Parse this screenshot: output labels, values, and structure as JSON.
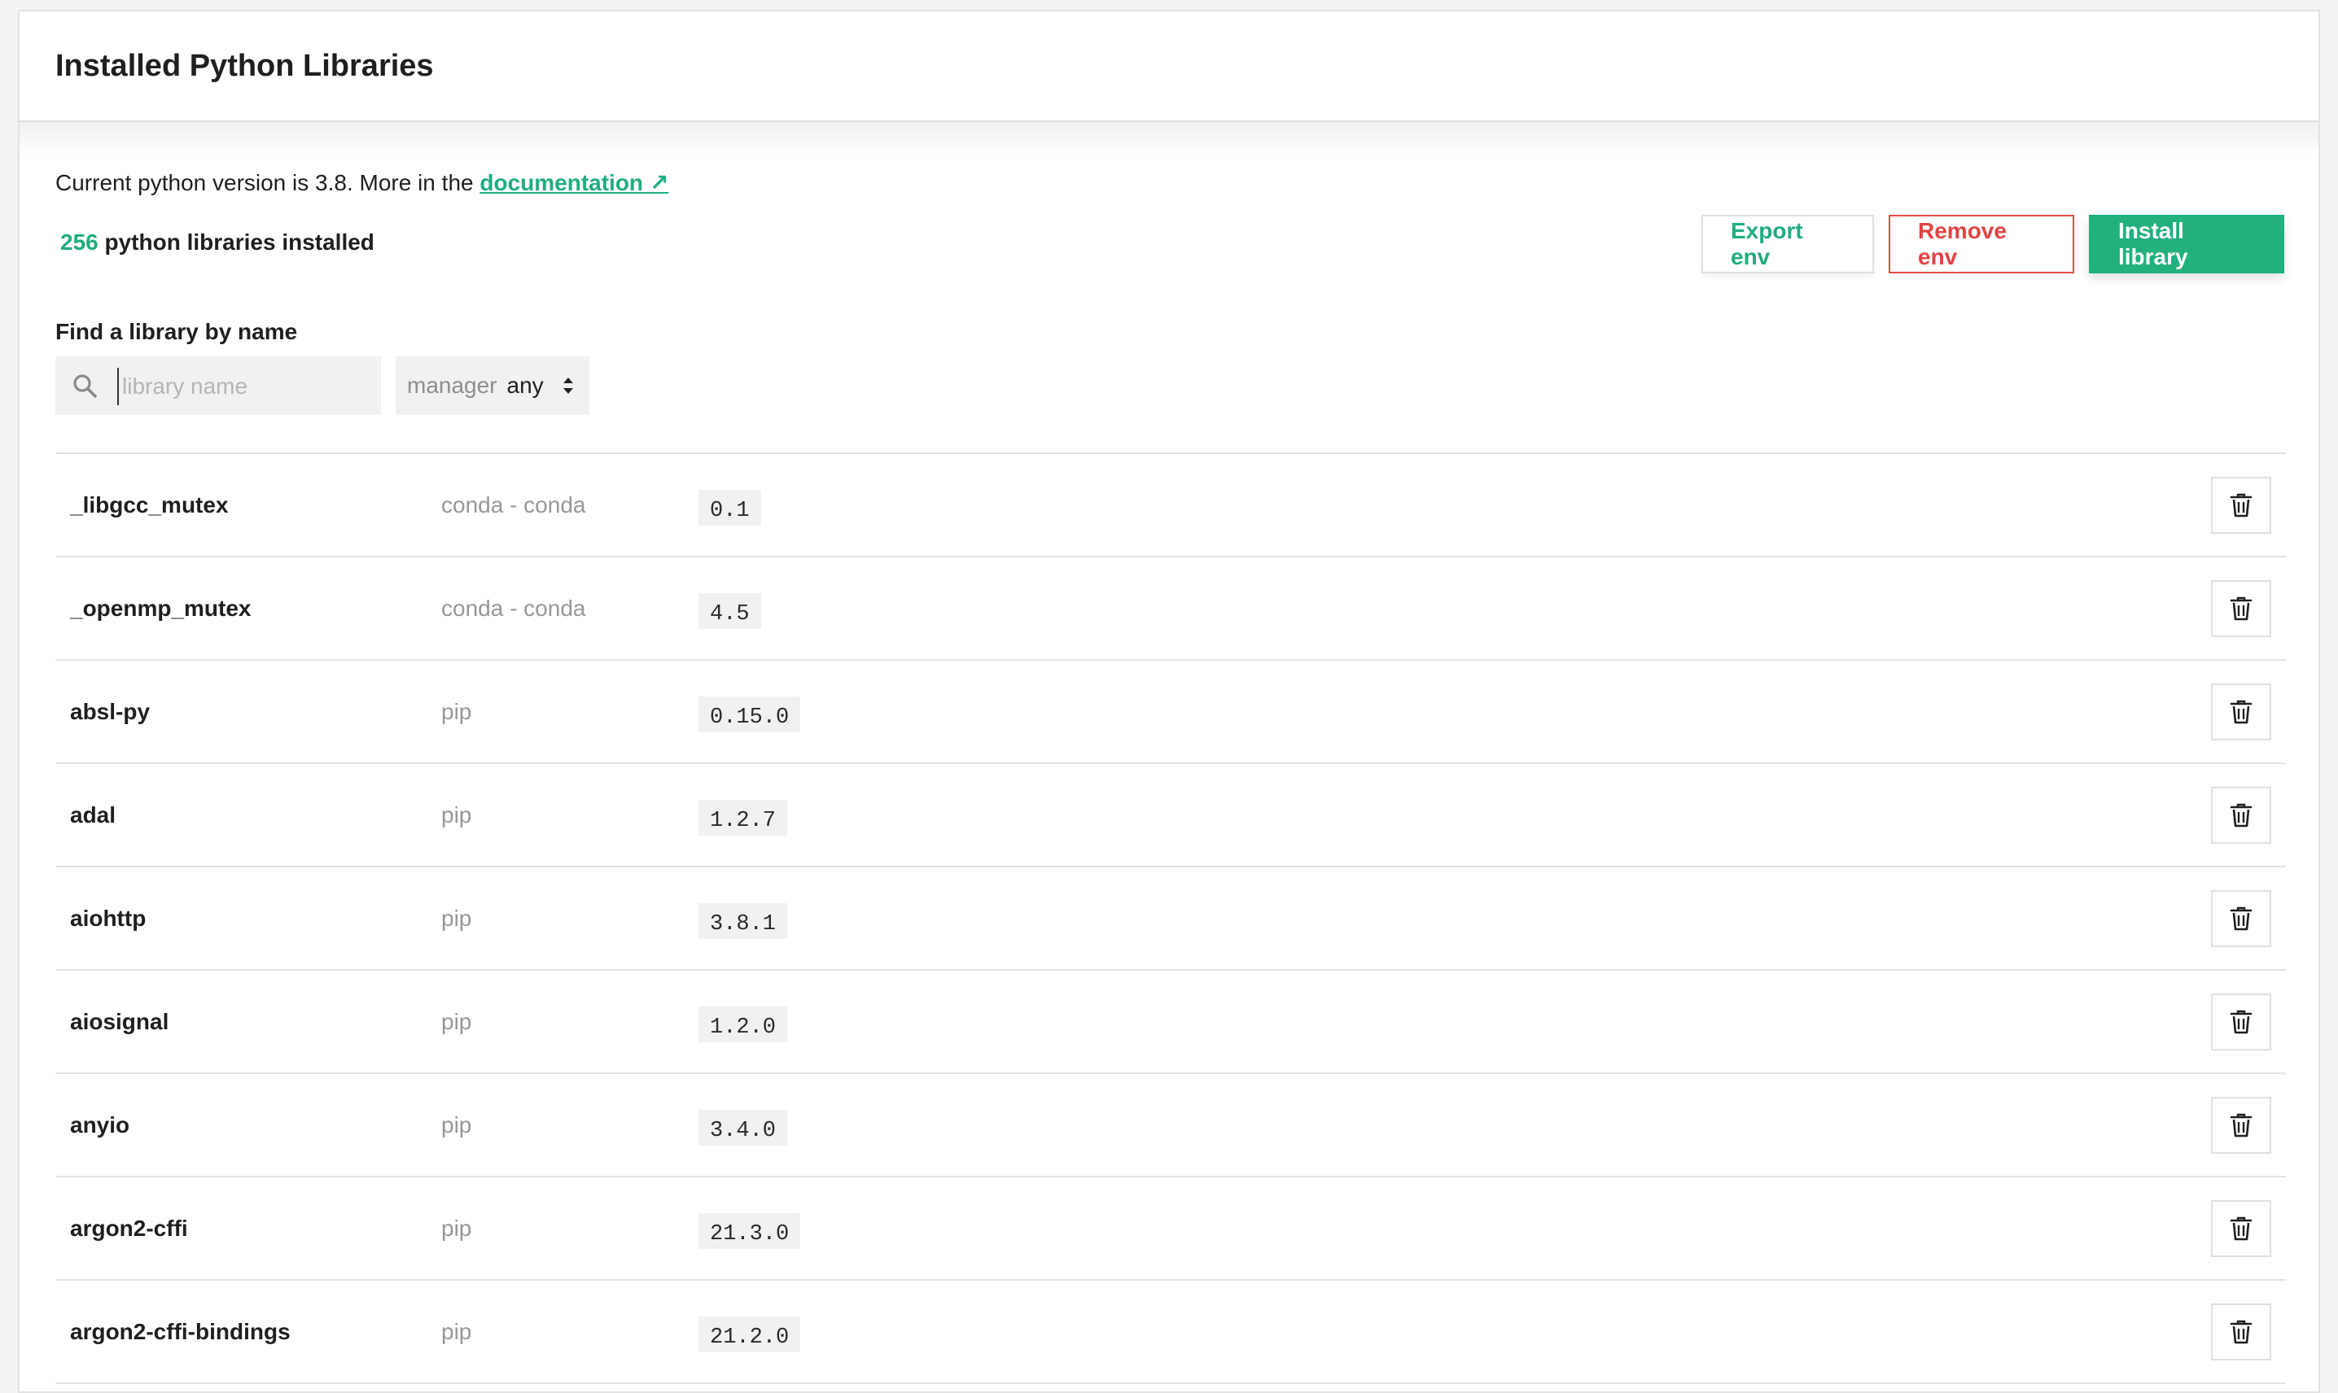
{
  "header": {
    "title": "Installed Python Libraries"
  },
  "info": {
    "version_text": "Current python version is 3.8. More in the ",
    "doc_link": "documentation ↗",
    "count": "256",
    "count_suffix": " python libraries installed"
  },
  "actions": {
    "export": "Export env",
    "remove": "Remove env",
    "install": "Install library"
  },
  "search": {
    "label": "Find a library by name",
    "placeholder": "library name",
    "manager_label": "manager",
    "manager_value": "any"
  },
  "icons": {
    "search": "search-icon",
    "updown": "chevron-updown-icon",
    "delete": "trash-icon"
  },
  "colors": {
    "accent": "#22b07d",
    "danger": "#e04343",
    "muted": "#979797"
  },
  "libraries": [
    {
      "name": "_libgcc_mutex",
      "manager": "conda - conda",
      "version": "0.1"
    },
    {
      "name": "_openmp_mutex",
      "manager": "conda - conda",
      "version": "4.5"
    },
    {
      "name": "absl-py",
      "manager": "pip",
      "version": "0.15.0"
    },
    {
      "name": "adal",
      "manager": "pip",
      "version": "1.2.7"
    },
    {
      "name": "aiohttp",
      "manager": "pip",
      "version": "3.8.1"
    },
    {
      "name": "aiosignal",
      "manager": "pip",
      "version": "1.2.0"
    },
    {
      "name": "anyio",
      "manager": "pip",
      "version": "3.4.0"
    },
    {
      "name": "argon2-cffi",
      "manager": "pip",
      "version": "21.3.0"
    },
    {
      "name": "argon2-cffi-bindings",
      "manager": "pip",
      "version": "21.2.0"
    }
  ]
}
